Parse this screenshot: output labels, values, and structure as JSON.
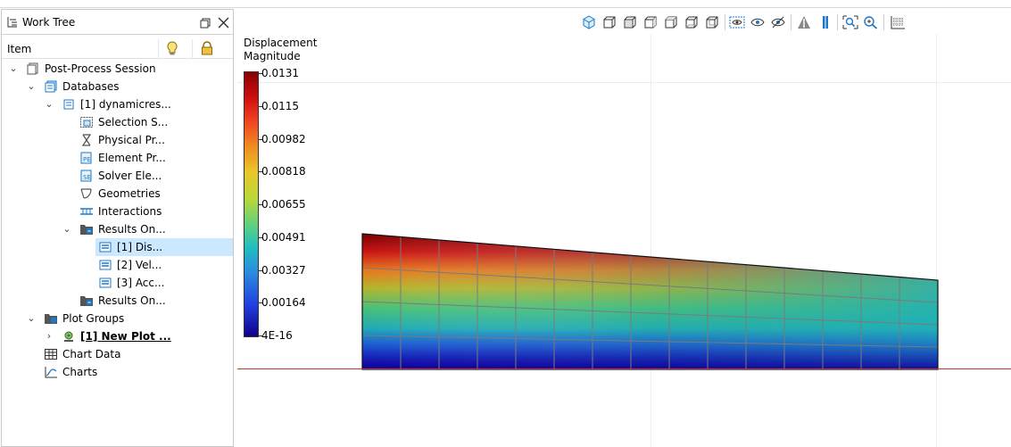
{
  "work_tree": {
    "title": "Work Tree",
    "column_item": "Item",
    "nodes": [
      {
        "label": "Post-Process Session",
        "icon": "post-process-session-icon"
      },
      {
        "label": "Databases",
        "icon": "databases-icon"
      },
      {
        "label": "[1] dynamicres...",
        "icon": "database-icon"
      },
      {
        "label": "Selection S...",
        "icon": "selection-set-icon"
      },
      {
        "label": "Physical Pr...",
        "icon": "physical-property-icon"
      },
      {
        "label": "Element Pr...",
        "icon": "element-property-icon"
      },
      {
        "label": "Solver Ele...",
        "icon": "solver-element-icon"
      },
      {
        "label": "Geometries",
        "icon": "geometry-icon"
      },
      {
        "label": "Interactions",
        "icon": "interactions-icon"
      },
      {
        "label": "Results On...",
        "icon": "results-folder-icon"
      },
      {
        "label": "[1] Dis...",
        "icon": "result-icon"
      },
      {
        "label": "[2] Vel...",
        "icon": "result-icon"
      },
      {
        "label": "[3] Acc...",
        "icon": "result-icon"
      },
      {
        "label": "Results On...",
        "icon": "results-folder-icon"
      },
      {
        "label": "Plot Groups",
        "icon": "plot-groups-icon"
      },
      {
        "label": "[1] New Plot ...",
        "icon": "plot-icon"
      },
      {
        "label": "Chart Data",
        "icon": "chart-data-icon"
      },
      {
        "label": "Charts",
        "icon": "charts-icon"
      }
    ]
  },
  "viewport": {
    "legend_title_line1": "Displacement",
    "legend_title_line2": "Magnitude",
    "legend_ticks": [
      "0.0131",
      "0.0115",
      "0.00982",
      "0.00818",
      "0.00655",
      "0.00491",
      "0.00327",
      "0.00164",
      "4E-16"
    ]
  },
  "colors": {
    "selection": "#cce8ff",
    "accent_blue": "#1e78c8",
    "ground_line": "#c0392b"
  }
}
